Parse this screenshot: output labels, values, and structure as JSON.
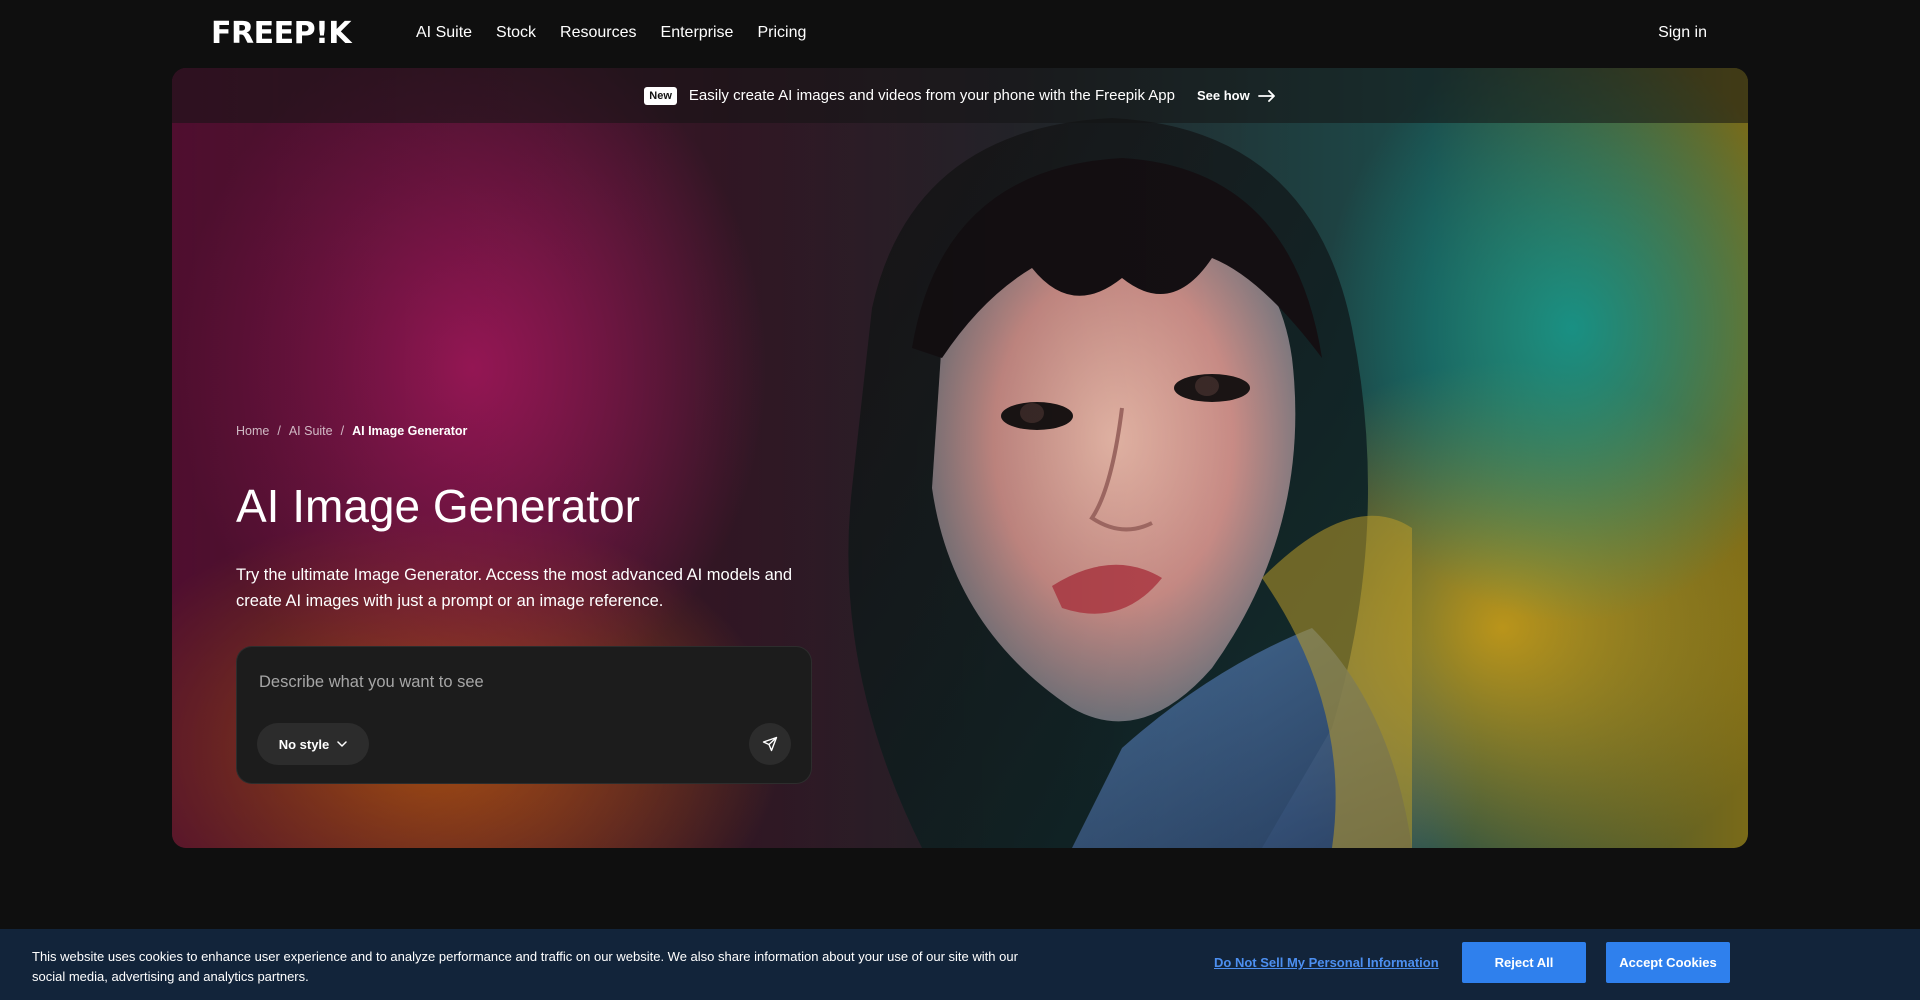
{
  "header": {
    "logo": "FREEP!K",
    "nav": [
      {
        "label": "AI Suite"
      },
      {
        "label": "Stock"
      },
      {
        "label": "Resources"
      },
      {
        "label": "Enterprise"
      },
      {
        "label": "Pricing"
      }
    ],
    "signin": "Sign in"
  },
  "announcement": {
    "badge": "New",
    "text": "Easily create AI images and videos from your phone with the Freepik App",
    "cta": "See how"
  },
  "breadcrumb": [
    {
      "label": "Home"
    },
    {
      "label": "AI Suite"
    },
    {
      "label": "AI Image Generator"
    }
  ],
  "hero": {
    "title": "AI Image Generator",
    "subtitle": "Try the ultimate Image Generator. Access the most advanced AI models and create AI images with just a prompt or an image reference."
  },
  "prompt": {
    "placeholder": "Describe what you want to see",
    "value": "",
    "style_label": "No style"
  },
  "cookie": {
    "text": "This website uses cookies to enhance user experience and to analyze performance and traffic on our website. We also share information about your use of our site with our social media, advertising and analytics partners.",
    "link": "Do Not Sell My Personal Information",
    "reject": "Reject All",
    "accept": "Accept Cookies"
  },
  "colors": {
    "page_bg": "#0f0f0f",
    "prompt_bg": "#1c1c1c",
    "cookie_bg": "#12243a",
    "cookie_button": "#2f80ed",
    "cookie_link": "#4c8ff0"
  },
  "icons": {
    "arrow": "arrow-right-icon",
    "chevron": "chevron-down-icon",
    "send": "send-icon"
  }
}
